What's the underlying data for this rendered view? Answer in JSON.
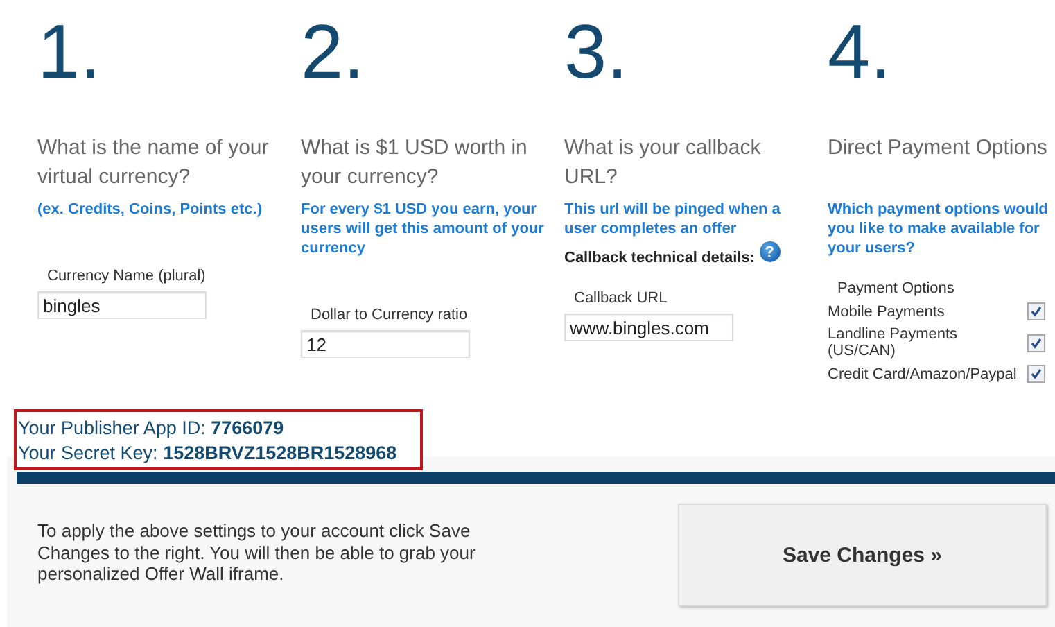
{
  "steps": [
    {
      "kind": "field",
      "number": "1.",
      "question": "What is the name of your virtual currency?",
      "hint": "(ex. Credits, Coins, Points etc.)",
      "field": {
        "label": "Currency Name (plural)",
        "value": "bingles"
      }
    },
    {
      "kind": "field",
      "number": "2.",
      "question": "What is $1 USD worth in your currency?",
      "hint": "For every $1 USD you earn, your users will get this amount of your currency",
      "field": {
        "label": "Dollar to Currency ratio",
        "value": "12"
      }
    },
    {
      "kind": "field",
      "number": "3.",
      "question": "What is your callback URL?",
      "hint": "This url will be pinged when a user completes an offer",
      "details": "Callback technical details:",
      "help": "?",
      "field": {
        "label": "Callback URL",
        "value": "www.bingles.com"
      }
    },
    {
      "kind": "options",
      "number": "4.",
      "question": "Direct Payment Options",
      "hint": "Which payment options would you like to make available for your users?",
      "options": {
        "label": "Payment Options",
        "items": [
          {
            "label": "Mobile Payments",
            "checked": true
          },
          {
            "label": "Landline Payments (US/CAN)",
            "checked": true
          },
          {
            "label": "Credit Card/Amazon/Paypal",
            "checked": true
          }
        ]
      }
    }
  ],
  "credentials": [
    {
      "label": "Your Publisher App ID:",
      "value": "7766079"
    },
    {
      "label": "Your Secret Key:",
      "value": "1528BRVZ1528BR1528968"
    }
  ],
  "footer": {
    "text": "To apply the above settings to your account click Save Changes to the right. You will then be able to grab your personalized Offer Wall iframe.",
    "button": "Save Changes »"
  }
}
